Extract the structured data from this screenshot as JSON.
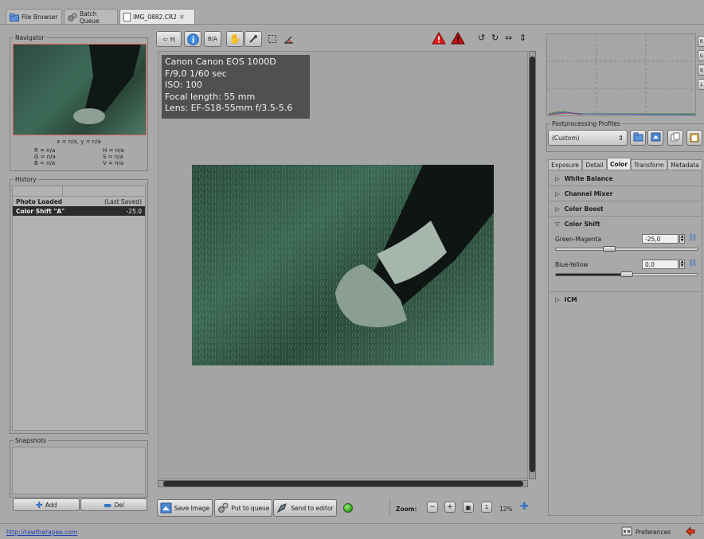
{
  "tabs": [
    {
      "label": "File Browser"
    },
    {
      "label": "Batch Queue"
    },
    {
      "label": "IMG_0882.CR2"
    }
  ],
  "navigator": {
    "title": "Navigator",
    "coords": "x = n/a, y = n/a",
    "r": "R = n/a",
    "g": "G = n/a",
    "b": "B = n/a",
    "h": "H = n/a",
    "s": "S = n/a",
    "v": "V = n/a"
  },
  "history": {
    "title": "History",
    "rows": [
      {
        "name": "Photo Loaded",
        "value": "(Last Saved)"
      },
      {
        "name": "Color Shift \"A\"",
        "value": "-25.0"
      }
    ]
  },
  "snapshots": {
    "title": "Snapshots",
    "add_label": "Add",
    "del_label": "Del"
  },
  "toolbar": {
    "history_label": "H",
    "before_after_label": "B|A"
  },
  "exif": {
    "camera": "Canon Canon EOS 1000D",
    "exposure": "F/9,0 1/60 sec",
    "iso": "ISO: 100",
    "focal": "Focal length: 55 mm",
    "lens": "Lens: EF-S18-55mm f/3.5-5.6"
  },
  "bottom_bar": {
    "save_label": "Save Image",
    "queue_label": "Put to queue",
    "editor_label": "Send to editor",
    "zoom_label": "Zoom:",
    "zoom_value": "12%"
  },
  "profiles": {
    "title": "Postprocessing Profiles",
    "selected": "(Custom)"
  },
  "right_tabs": [
    {
      "label": "Exposure"
    },
    {
      "label": "Detail"
    },
    {
      "label": "Color"
    },
    {
      "label": "Transform"
    },
    {
      "label": "Metadata"
    }
  ],
  "tools": {
    "white_balance": "White Balance",
    "channel_mixer": "Channel Mixer",
    "color_boost": "Color Boost",
    "color_shift": "Color Shift",
    "icm": "ICM"
  },
  "color_shift": {
    "green_magenta_label": "Green-Magenta",
    "green_magenta_value": "-25,0",
    "green_magenta_level": -25,
    "blue_yellow_label": "Blue-Yellow",
    "blue_yellow_value": "0,0",
    "blue_yellow_level": 0
  },
  "status": {
    "link": "http://rawtherapee.com",
    "preferences_label": "Preferences"
  },
  "colors": {
    "active_history_row": "#2b2b2b",
    "status_ok": "#3fae2a",
    "warning_red": "#e01b1b"
  }
}
